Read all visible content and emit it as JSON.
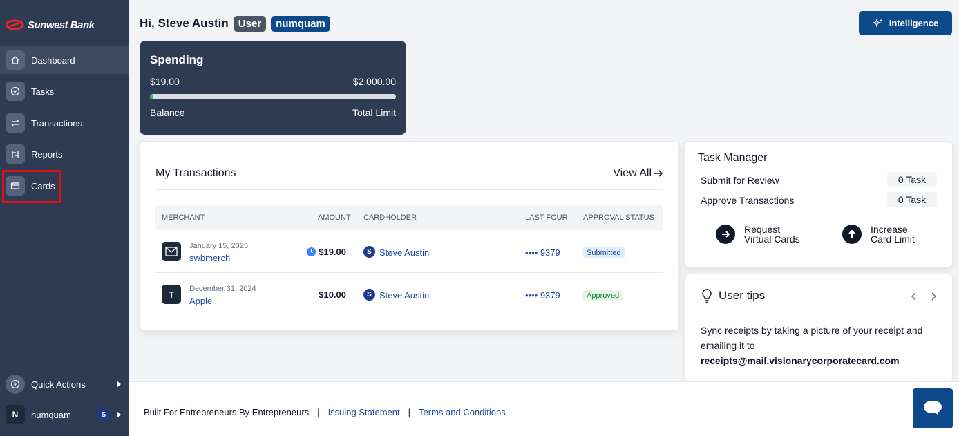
{
  "brand": {
    "name": "Sunwest Bank"
  },
  "sidebar": {
    "items": [
      {
        "label": "Dashboard",
        "icon": "home-icon"
      },
      {
        "label": "Tasks",
        "icon": "check-circle-icon"
      },
      {
        "label": "Transactions",
        "icon": "swap-icon"
      },
      {
        "label": "Reports",
        "icon": "reports-icon"
      },
      {
        "label": "Cards",
        "icon": "card-icon"
      }
    ],
    "active": "Dashboard",
    "quick_actions_label": "Quick Actions",
    "account": {
      "initial": "N",
      "name": "numquam",
      "badge": "S"
    }
  },
  "header": {
    "greeting": "Hi, Steve Austin",
    "role_pill": "User",
    "org_pill": "numquam",
    "intelligence_label": "Intelligence"
  },
  "spending": {
    "title": "Spending",
    "balance": "$19.00",
    "limit": "$2,000.00",
    "balance_label": "Balance",
    "limit_label": "Total Limit",
    "progress_fraction": 0.0095
  },
  "transactions": {
    "title": "My Transactions",
    "view_all": "View All",
    "columns": [
      "MERCHANT",
      "AMOUNT",
      "CARDHOLDER",
      "LAST FOUR",
      "APPROVAL STATUS"
    ],
    "rows": [
      {
        "icon_letter": "",
        "date": "January 15, 2025",
        "merchant": "swbmerch",
        "amount": "$19.00",
        "cardholder_initial": "S",
        "cardholder": "Steve Austin",
        "last_four": "•••• 9379",
        "status": "Submitted"
      },
      {
        "icon_letter": "T",
        "date": "December 31, 2024",
        "merchant": "Apple",
        "amount": "$10.00",
        "cardholder_initial": "S",
        "cardholder": "Steve Austin",
        "last_four": "•••• 9379",
        "status": "Approved"
      }
    ]
  },
  "task_manager": {
    "title": "Task Manager",
    "rows": [
      {
        "label": "Submit for Review",
        "count": "0 Task"
      },
      {
        "label": "Approve Transactions",
        "count": "0 Task"
      }
    ],
    "actions": [
      {
        "line1": "Request",
        "line2": "Virtual Cards"
      },
      {
        "line1": "Increase",
        "line2": "Card Limit"
      }
    ]
  },
  "user_tips": {
    "title": "User tips",
    "text": "Sync receipts by taking a picture of your receipt and emailing it to",
    "email": "receipts@mail.visionarycorporatecard.com"
  },
  "footer": {
    "tagline": "Built For Entrepreneurs By Entrepreneurs",
    "separator": "|",
    "link1": "Issuing Statement",
    "link2": "Terms and Conditions"
  },
  "colors": {
    "sidebar_bg": "#2f3b52",
    "accent": "#0d4a8c",
    "link": "#1e4d9b",
    "highlight": "#e01010"
  }
}
